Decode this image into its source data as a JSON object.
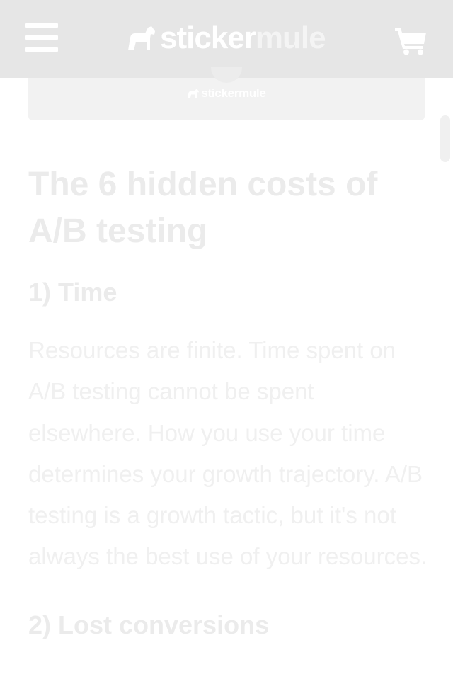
{
  "header": {
    "logo_word_1": "sticker",
    "logo_word_2": "mule",
    "background": "#e6e6e6",
    "icons": [
      "menu-icon",
      "mule-logo-icon",
      "cart-icon"
    ]
  },
  "hero": {
    "logo_text": "stickermule"
  },
  "article": {
    "title": "The 6 hidden costs of A/B testing",
    "sections": [
      {
        "heading": "1) Time",
        "body": "Resources are finite. Time spent on A/B testing cannot be spent elsewhere. How you use your time determines your growth trajectory. A/B testing is a growth tactic, but it's not always the best use of your resources."
      },
      {
        "heading": "2) Lost conversions"
      }
    ]
  }
}
